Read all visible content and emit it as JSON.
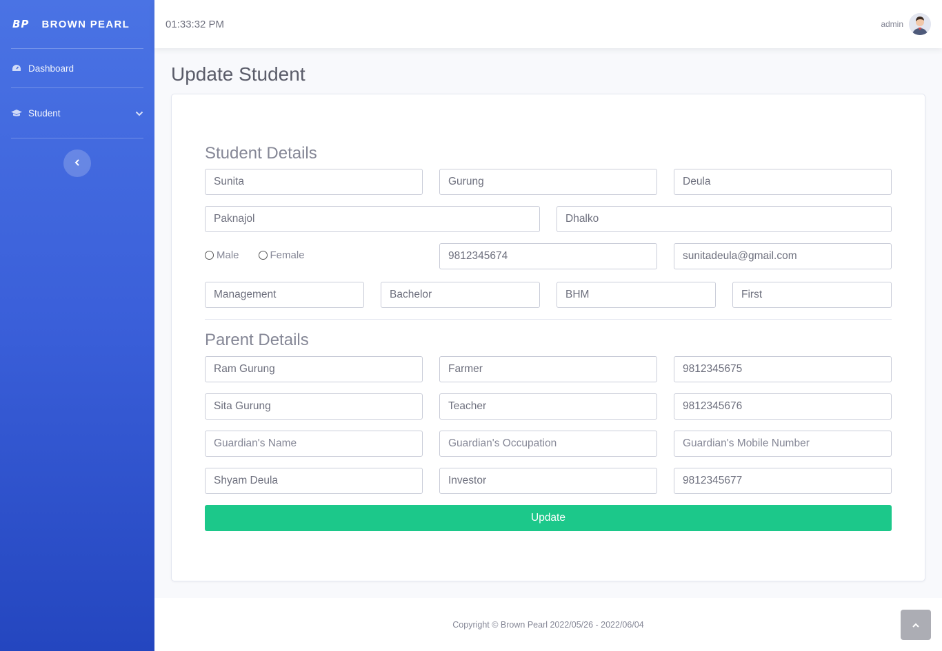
{
  "brand": {
    "logo": "BP",
    "name": "BROWN PEARL"
  },
  "sidebar": {
    "items": [
      {
        "label": "Dashboard",
        "icon": "gauge-icon"
      },
      {
        "label": "Student",
        "icon": "graduation-cap-icon"
      }
    ]
  },
  "topbar": {
    "time": "01:33:32 PM",
    "username": "admin"
  },
  "page": {
    "title": "Update Student"
  },
  "student": {
    "section_title": "Student Details",
    "first_name": "Sunita",
    "middle_name": "Gurung",
    "last_name": "Deula",
    "address1": "Paknajol",
    "address2": "Dhalko",
    "gender_male": "Male",
    "gender_female": "Female",
    "mobile": "9812345674",
    "email": "sunitadeula@gmail.com",
    "faculty": "Management",
    "level": "Bachelor",
    "program": "BHM",
    "year": "First"
  },
  "parent": {
    "section_title": "Parent Details",
    "father_name": "Ram Gurung",
    "father_occupation": "Farmer",
    "father_mobile": "9812345675",
    "mother_name": "Sita Gurung",
    "mother_occupation": "Teacher",
    "mother_mobile": "9812345676",
    "guardian_name_placeholder": "Guardian's Name",
    "guardian_occupation_placeholder": "Guardian's Occupation",
    "guardian_mobile_placeholder": "Guardian's Mobile Number",
    "other_name": "Shyam Deula",
    "other_occupation": "Investor",
    "other_mobile": "9812345677"
  },
  "form": {
    "submit_label": "Update"
  },
  "footer": {
    "copyright": "Copyright © Brown Pearl 2022/05/26 - 2022/06/04"
  },
  "colors": {
    "sidebar_top": "#4a73e4",
    "sidebar_bottom": "#2446bf",
    "success": "#1cc88a"
  }
}
